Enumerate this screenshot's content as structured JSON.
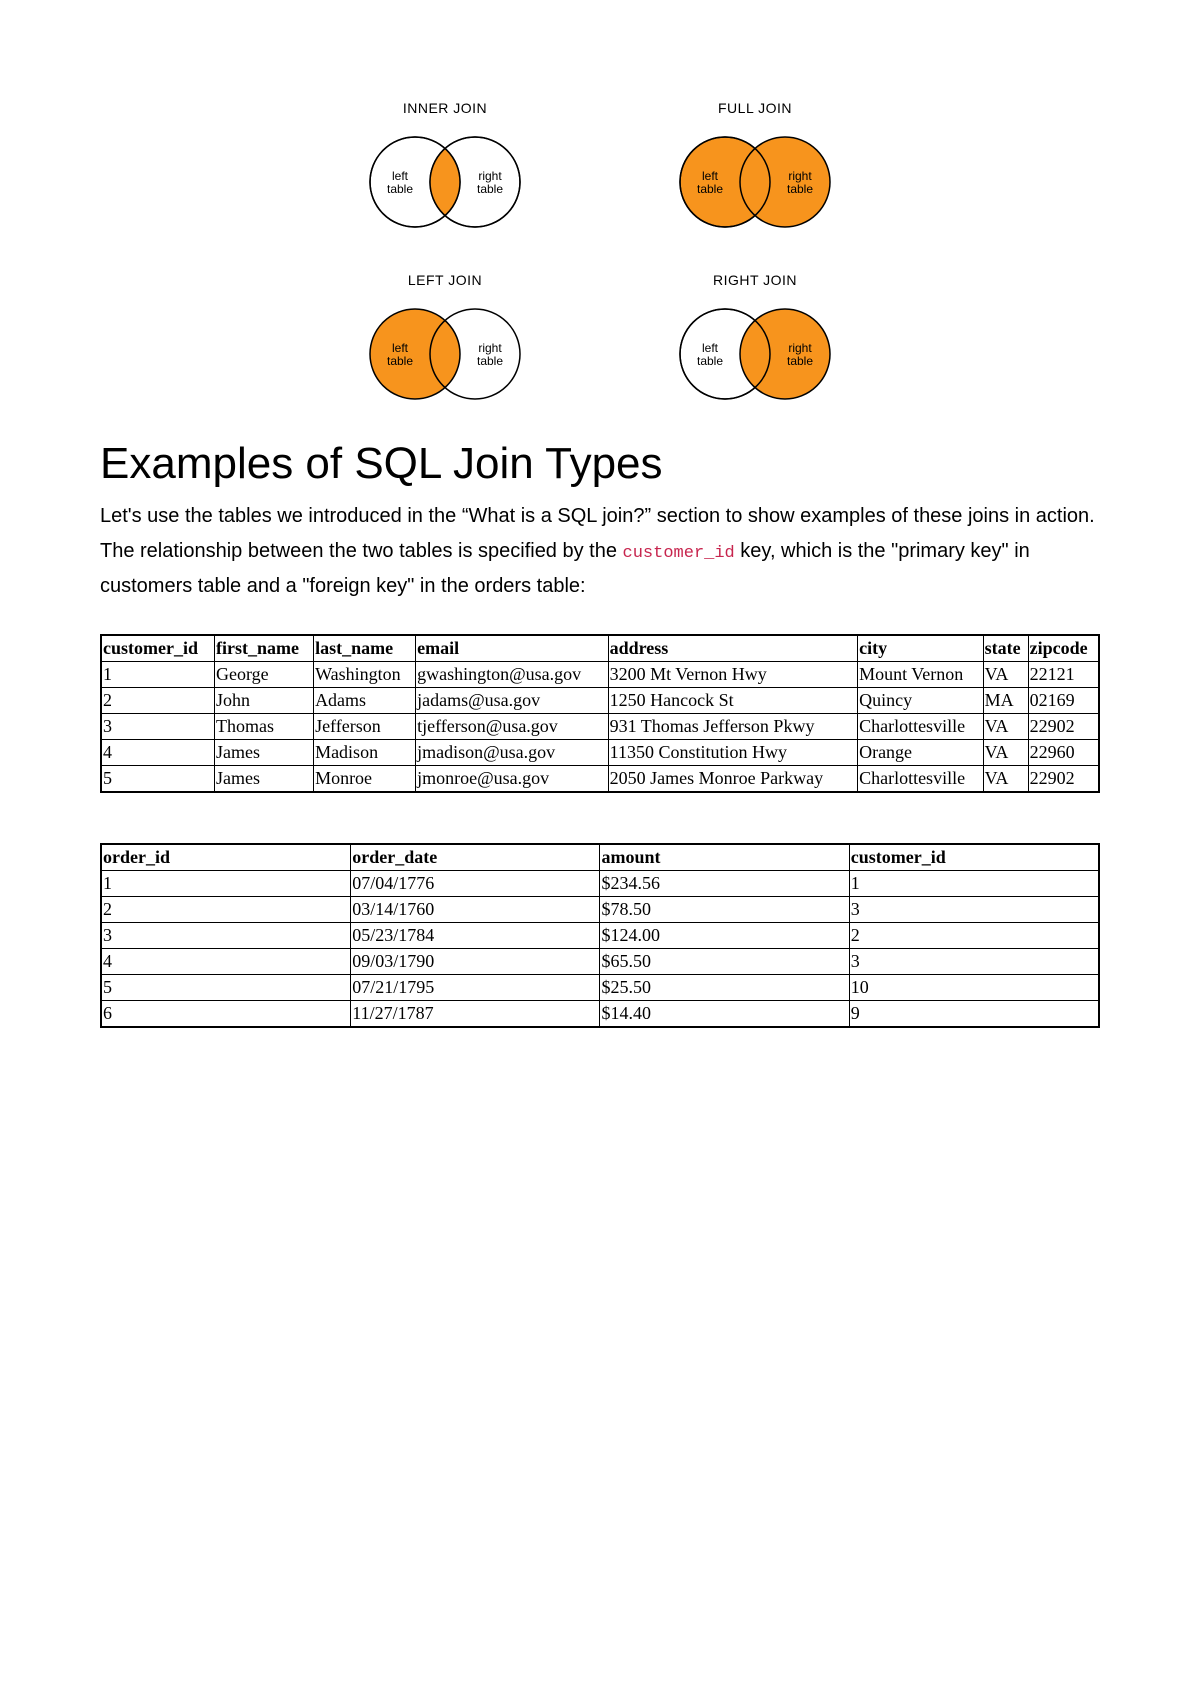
{
  "venns": {
    "inner": {
      "title": "INNER JOIN",
      "left_label": "left\ntable",
      "right_label": "right\ntable"
    },
    "full": {
      "title": "FULL JOIN",
      "left_label": "left\ntable",
      "right_label": "right\ntable"
    },
    "left": {
      "title": "LEFT JOIN",
      "left_label": "left\ntable",
      "right_label": "right\ntable"
    },
    "right": {
      "title": "RIGHT JOIN",
      "left_label": "left\ntable",
      "right_label": "right\ntable"
    }
  },
  "heading": "Examples of SQL Join Types",
  "intro_parts": {
    "p1": "Let's use the tables we introduced in the “What is a SQL join?” section to show examples of these joins in action. The relationship between the two tables is specified by the ",
    "key": "customer_id",
    "p2": " key, which is the \"primary key\" in customers table and a \"foreign key\" in the orders table:"
  },
  "customers": {
    "headers": [
      "customer_id",
      "first_name",
      "last_name",
      "email",
      "address",
      "city",
      "state",
      "zipcode"
    ],
    "rows": [
      [
        "1",
        "George",
        "Washington",
        "gwashington@usa.gov",
        "3200 Mt Vernon Hwy",
        "Mount Vernon",
        "VA",
        "22121"
      ],
      [
        "2",
        "John",
        "Adams",
        "jadams@usa.gov",
        "1250 Hancock St",
        "Quincy",
        "MA",
        "02169"
      ],
      [
        "3",
        "Thomas",
        "Jefferson",
        "tjefferson@usa.gov",
        "931 Thomas Jefferson Pkwy",
        "Charlottesville",
        "VA",
        "22902"
      ],
      [
        "4",
        "James",
        "Madison",
        "jmadison@usa.gov",
        "11350 Constitution Hwy",
        "Orange",
        "VA",
        "22960"
      ],
      [
        "5",
        "James",
        "Monroe",
        "jmonroe@usa.gov",
        "2050 James Monroe Parkway",
        "Charlottesville",
        "VA",
        "22902"
      ]
    ]
  },
  "orders": {
    "headers": [
      "order_id",
      "order_date",
      "amount",
      "customer_id"
    ],
    "rows": [
      [
        "1",
        "07/04/1776",
        "$234.56",
        "1"
      ],
      [
        "2",
        "03/14/1760",
        "$78.50",
        "3"
      ],
      [
        "3",
        "05/23/1784",
        "$124.00",
        "2"
      ],
      [
        "4",
        "09/03/1790",
        "$65.50",
        "3"
      ],
      [
        "5",
        "07/21/1795",
        "$25.50",
        "10"
      ],
      [
        "6",
        "11/27/1787",
        "$14.40",
        "9"
      ]
    ]
  }
}
